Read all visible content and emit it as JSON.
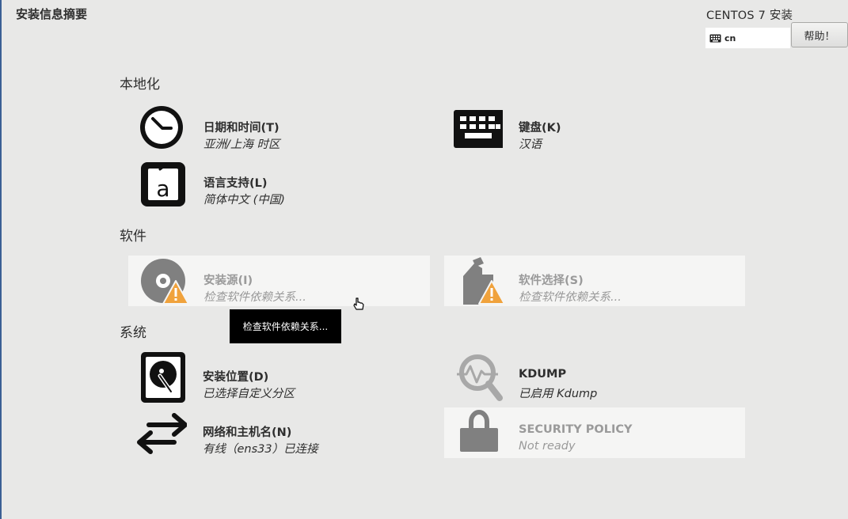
{
  "header": {
    "page_title": "安装信息摘要",
    "product_title": "CENTOS 7 安装",
    "keyboard_layout": "cn",
    "help_label": "帮助！"
  },
  "sections": {
    "localization": {
      "heading": "本地化",
      "datetime": {
        "title": "日期和时间(T)",
        "status": "亚洲/上海 时区"
      },
      "keyboard": {
        "title": "键盘(K)",
        "status": "汉语"
      },
      "language": {
        "title": "语言支持(L)",
        "status": "简体中文 (中国)"
      }
    },
    "software": {
      "heading": "软件",
      "install_source": {
        "title": "安装源(I)",
        "status": "检查软件依赖关系..."
      },
      "software_selection": {
        "title": "软件选择(S)",
        "status": "检查软件依赖关系..."
      }
    },
    "system": {
      "heading": "系统",
      "install_destination": {
        "title": "安装位置(D)",
        "status": "已选择自定义分区"
      },
      "kdump": {
        "title": "KDUMP",
        "status": "已启用 Kdump"
      },
      "network": {
        "title": "网络和主机名(N)",
        "status": "有线（ens33）已连接"
      },
      "security_policy": {
        "title": "SECURITY POLICY",
        "status": "Not ready"
      }
    }
  },
  "tooltip": "检查软件依赖关系...",
  "icons": {
    "clock": "clock-icon",
    "keyboard": "keyboard-icon",
    "language": "language-icon",
    "disc": "disc-icon",
    "package": "package-icon",
    "warning": "warning-icon",
    "disk": "hard-disk-icon",
    "search": "magnifier-icon",
    "network": "network-arrows-icon",
    "lock": "lock-icon"
  },
  "colors": {
    "background": "#e8e8e7",
    "warning": "#f0a23c",
    "dim_text": "#9a9a9a",
    "icon_dark": "#111111"
  }
}
